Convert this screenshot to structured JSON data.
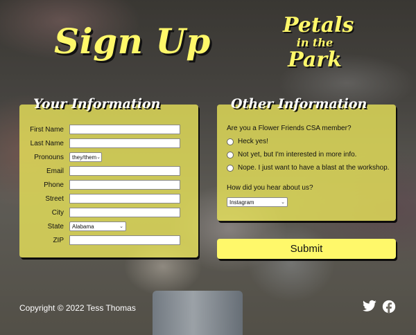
{
  "page": {
    "title": "Sign Up",
    "logo": {
      "line1": "Petals",
      "line2": "in the",
      "line3": "Park"
    },
    "accent_color": "#fff86a",
    "panel_color": "#ece75a"
  },
  "your_info": {
    "heading": "Your Information",
    "fields": {
      "first_name": {
        "label": "First Name",
        "value": ""
      },
      "last_name": {
        "label": "Last Name",
        "value": ""
      },
      "pronouns": {
        "label": "Pronouns",
        "selected": "they/them"
      },
      "email": {
        "label": "Email",
        "value": ""
      },
      "phone": {
        "label": "Phone",
        "value": ""
      },
      "street": {
        "label": "Street",
        "value": ""
      },
      "city": {
        "label": "City",
        "value": ""
      },
      "state": {
        "label": "State",
        "selected": "Alabama"
      },
      "zip": {
        "label": "ZIP",
        "value": ""
      }
    }
  },
  "other_info": {
    "heading": "Other Information",
    "question1": "Are you a Flower Friends CSA member?",
    "options": [
      "Heck yes!",
      "Not yet, but I'm interested in more info.",
      "Nope. I just want to have a blast at the workshop."
    ],
    "question2": "How did you hear about us?",
    "source_selected": "Instagram"
  },
  "submit_label": "Submit",
  "footer": {
    "copyright": "Copyright © 2022 Tess Thomas",
    "icons": [
      "twitter-icon",
      "facebook-icon"
    ]
  }
}
